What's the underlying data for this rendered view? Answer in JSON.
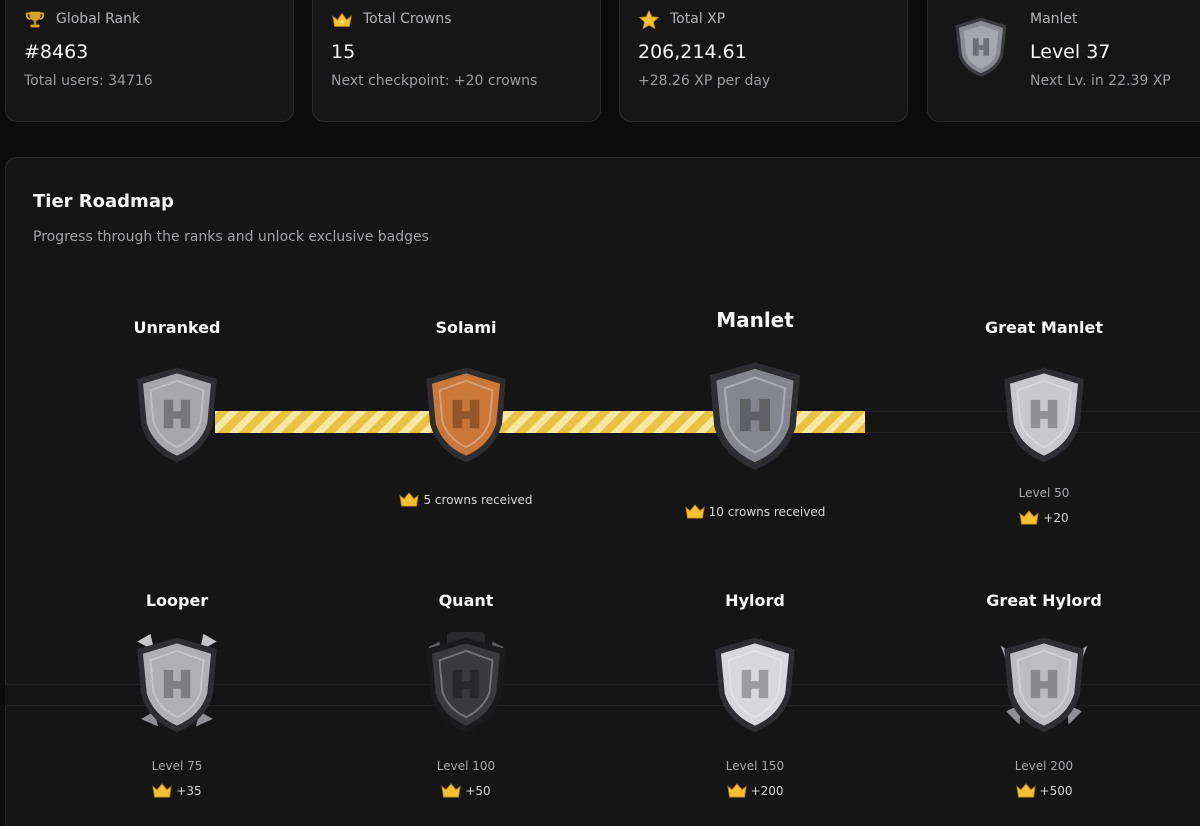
{
  "stats": {
    "rank": {
      "label": "Global Rank",
      "value": "#8463",
      "sub": "Total users: 34716",
      "icon": "trophy-icon"
    },
    "crowns": {
      "label": "Total Crowns",
      "value": "15",
      "sub": "Next checkpoint: +20 crowns",
      "icon": "crown-icon"
    },
    "xp": {
      "label": "Total XP",
      "value": "206,214.61",
      "sub": "+28.26 XP per day",
      "icon": "star-icon"
    },
    "level": {
      "label": "Manlet",
      "value": "Level 37",
      "sub": "Next Lv. in 22.39 XP",
      "icon": "manlet-badge-icon"
    }
  },
  "roadmap": {
    "title": "Tier Roadmap",
    "subtitle": "Progress through the ranks and unlock exclusive badges",
    "progress_to_next_tier": 0.55,
    "tiers": [
      {
        "name": "Unranked",
        "level": "",
        "reward": "",
        "color": "#a6a6ab",
        "status": "achieved"
      },
      {
        "name": "Solami",
        "level": "",
        "reward": "5 crowns received",
        "color": "#c9783a",
        "status": "achieved"
      },
      {
        "name": "Manlet",
        "level": "",
        "reward": "10 crowns received",
        "color": "#85858d",
        "status": "current"
      },
      {
        "name": "Great Manlet",
        "level": "Level 50",
        "reward": "+20",
        "color": "#c8c8cc",
        "status": "locked"
      },
      {
        "name": "Looper",
        "level": "Level 75",
        "reward": "+35",
        "color": "#b0b0b4",
        "status": "locked"
      },
      {
        "name": "Quant",
        "level": "Level 100",
        "reward": "+50",
        "color": "#3a3a3d",
        "status": "locked"
      },
      {
        "name": "Hylord",
        "level": "Level 150",
        "reward": "+200",
        "color": "#d8d8dc",
        "status": "locked"
      },
      {
        "name": "Great Hylord",
        "level": "Level 200",
        "reward": "+500",
        "color": "#bdbdc1",
        "status": "locked"
      }
    ]
  },
  "colors": {
    "gold": "#f5c12e",
    "track_stripe_a": "#e9c33f",
    "track_stripe_b": "#f6e7a6"
  }
}
